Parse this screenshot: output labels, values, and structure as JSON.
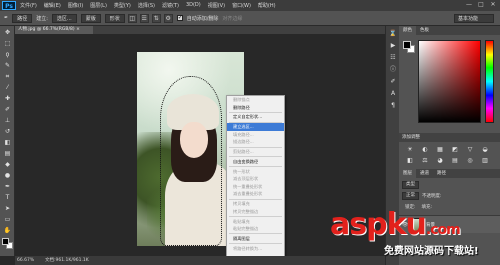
{
  "app": {
    "logo": "Ps",
    "menus": [
      "文件(F)",
      "编辑(E)",
      "图像(I)",
      "图层(L)",
      "类型(Y)",
      "选择(S)",
      "滤镜(T)",
      "3D(D)",
      "视图(V)",
      "窗口(W)",
      "帮助(H)"
    ],
    "window_buttons": [
      "—",
      "□",
      "✕"
    ]
  },
  "options_bar": {
    "mode_label": "路径",
    "make_label": "建立:",
    "select_button": "选区...",
    "mask_button": "蒙版",
    "shape_button": "形状",
    "auto_add_label": "自动添加/删除",
    "align_edges_label": "对齐边缘",
    "workspace": "基本功能"
  },
  "document": {
    "tab_title": "人物.jpg @ 66.7%(RGB/8) ×",
    "zoom": "66.67%",
    "doc_info": "文档:961.1K/961.1K"
  },
  "context_menu": {
    "items": [
      {
        "label": "删除锚点",
        "disabled": true
      },
      {
        "label": "删除路径",
        "disabled": false
      },
      {
        "sep": true
      },
      {
        "label": "定义自定形状...",
        "disabled": false
      },
      {
        "sep": true
      },
      {
        "label": "建立选区...",
        "disabled": false,
        "highlight": true
      },
      {
        "label": "填充路径...",
        "disabled": true
      },
      {
        "label": "描边路径...",
        "disabled": true
      },
      {
        "sep": true
      },
      {
        "label": "剪贴路径...",
        "disabled": true
      },
      {
        "sep": true
      },
      {
        "label": "自由变换路径",
        "disabled": false
      },
      {
        "sep": true
      },
      {
        "label": "统一形状",
        "disabled": true
      },
      {
        "label": "减去顶层形状",
        "disabled": true
      },
      {
        "label": "统一重叠处形状",
        "disabled": true
      },
      {
        "label": "减去重叠处形状",
        "disabled": true
      },
      {
        "sep": true
      },
      {
        "label": "拷贝填充",
        "disabled": true
      },
      {
        "label": "拷贝完整描边",
        "disabled": true
      },
      {
        "sep": true
      },
      {
        "label": "粘贴填充",
        "disabled": true
      },
      {
        "label": "粘贴完整描边",
        "disabled": true
      },
      {
        "sep": true
      },
      {
        "label": "隔离图层",
        "disabled": false
      },
      {
        "sep": true
      },
      {
        "label": "将路径转换为...",
        "disabled": true
      }
    ]
  },
  "panels": {
    "color_tabs": [
      "颜色",
      "色板"
    ],
    "adjustments_title": "添加调整",
    "adjust_icons": [
      "☀",
      "◐",
      "▦",
      "◩",
      "▽",
      "◒",
      "◧",
      "⚖",
      "◕",
      "▤",
      "◎",
      "▥"
    ],
    "layer_tabs": [
      "图层",
      "通道",
      "路径"
    ],
    "kind_label": "类型",
    "blend_mode": "正常",
    "opacity_label": "不透明度:",
    "lock_label": "锁定:",
    "fill_label": "填充:",
    "layer_name": "背景"
  },
  "watermark": {
    "main": "aspku",
    "suffix": ".com",
    "sub": "免费网站源码下载站!"
  }
}
